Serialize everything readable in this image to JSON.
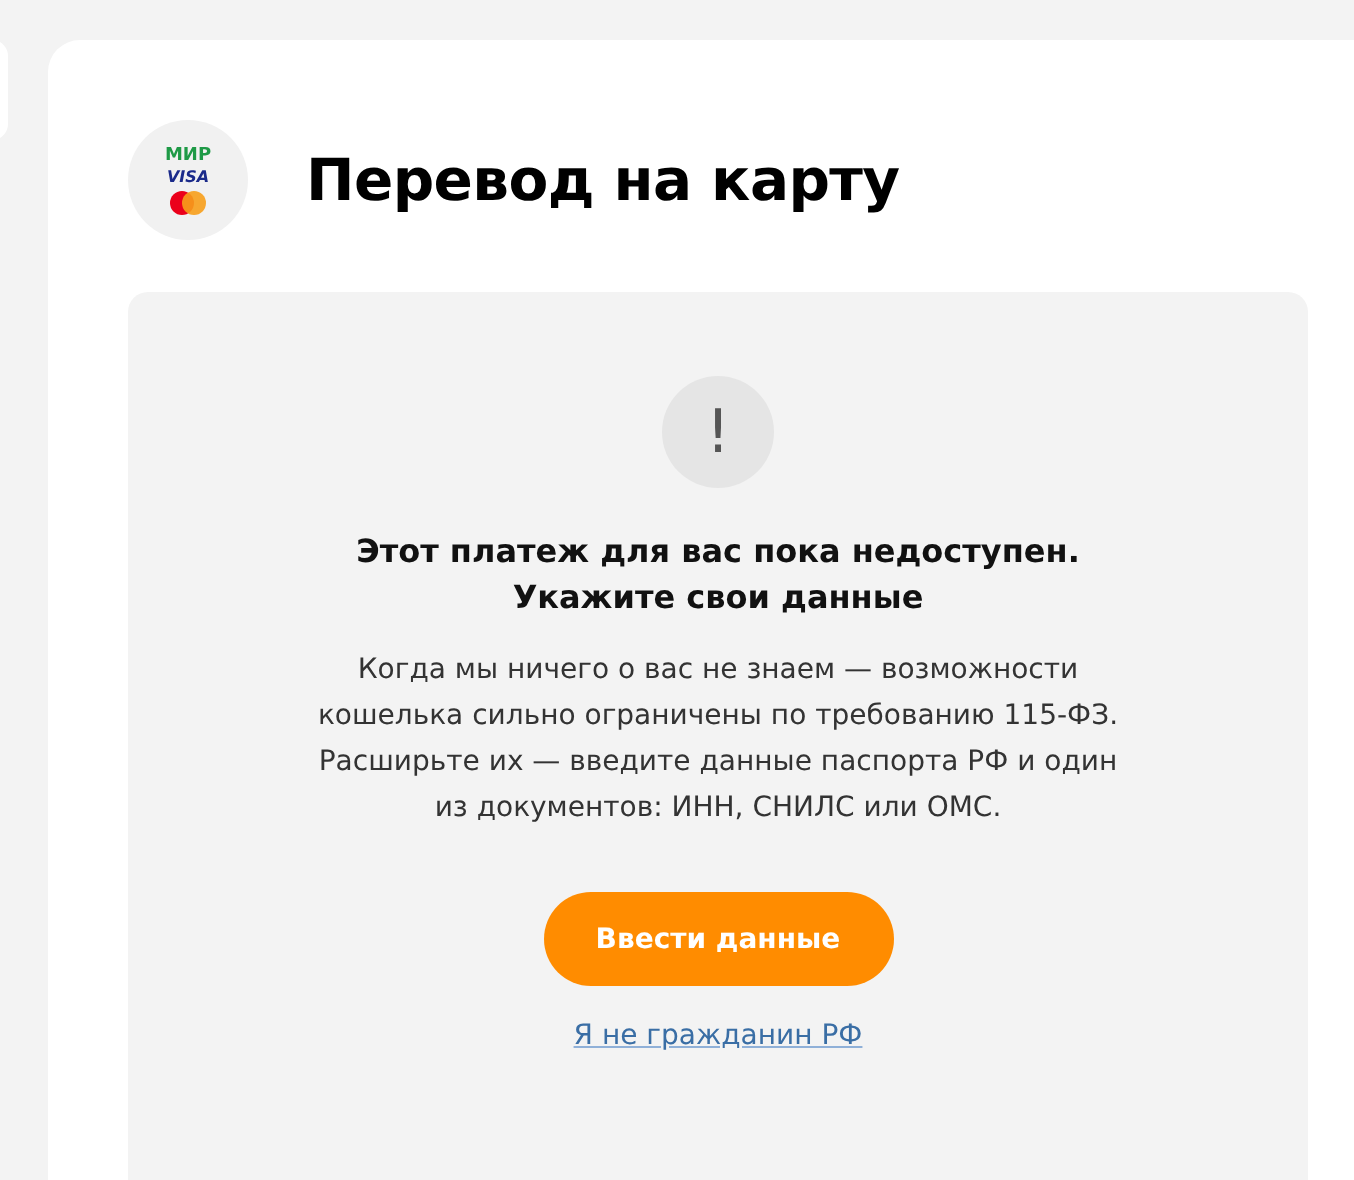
{
  "payment_logos": [
    "МИР",
    "VISA"
  ],
  "title": "Перевод на карту",
  "notice": {
    "icon": "!",
    "heading": [
      "Этот платеж для вас пока недоступен.",
      "Укажите свои данные"
    ],
    "body": "Когда мы ничего о вас не знаем — возможности кошелька сильно ограничены по требованию 115-ФЗ. Расширьте их — введите данные паспорта РФ и один из документов: ИНН, СНИЛС или ОМС.",
    "button": "Ввести данные",
    "link": "Я не гражданин РФ"
  }
}
